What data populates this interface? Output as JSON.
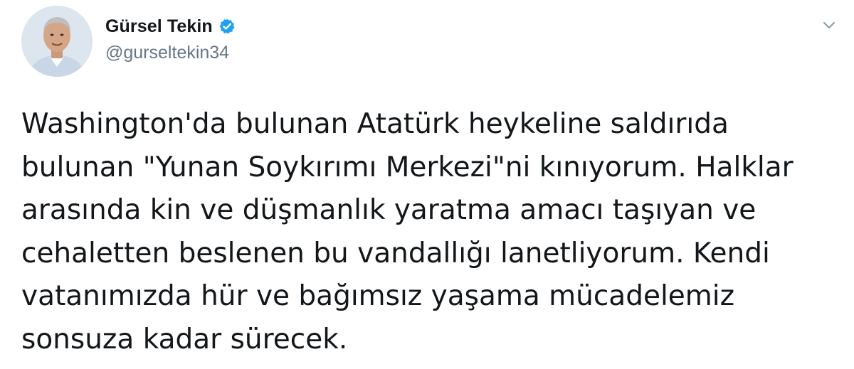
{
  "user": {
    "display_name": "Gürsel Tekin",
    "handle": "@gurseltekin34",
    "verified": true,
    "avatar": "profile-photo",
    "verified_color": "#1da1f2"
  },
  "controls": {
    "menu_icon": "chevron-down-icon"
  },
  "tweet": {
    "lines": [
      "Washington'da bulunan Atatürk heykeline saldırıda",
      "bulunan \"Yunan Soykırımı Merkezi\"ni kınıyorum. Halklar",
      "arasında kin ve düşmanlık yaratma amacı taşıyan ve",
      "cehaletten beslenen bu vandallığı lanetliyorum. Kendi",
      "vatanımızda hür ve bağımsız yaşama mücadelemiz",
      "sonsuza kadar sürecek."
    ]
  }
}
